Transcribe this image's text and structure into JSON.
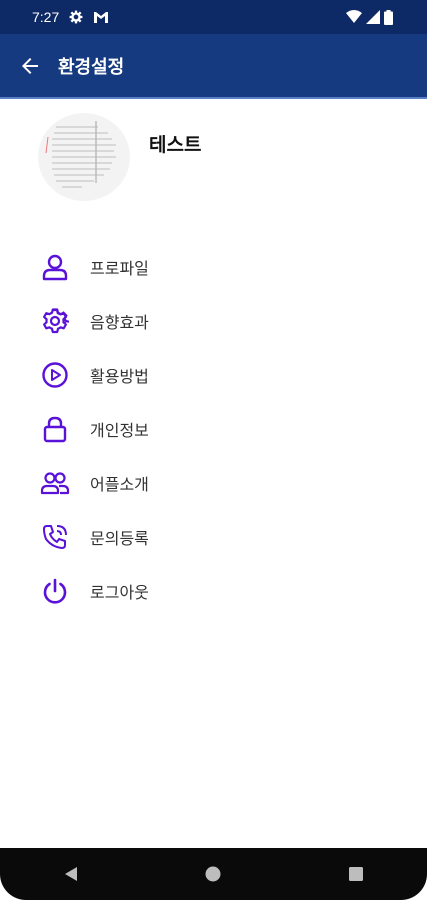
{
  "status_bar": {
    "time": "7:27"
  },
  "app_bar": {
    "title": "환경설정"
  },
  "profile": {
    "name": "테스트"
  },
  "menu": [
    {
      "label": "프로파일",
      "icon": "person-icon"
    },
    {
      "label": "음향효과",
      "icon": "gear-icon"
    },
    {
      "label": "활용방법",
      "icon": "play-circle-icon"
    },
    {
      "label": "개인정보",
      "icon": "lock-icon"
    },
    {
      "label": "어플소개",
      "icon": "people-icon"
    },
    {
      "label": "문의등록",
      "icon": "phone-icon"
    },
    {
      "label": "로그아웃",
      "icon": "power-icon"
    }
  ],
  "colors": {
    "status_bar": "#0e2a66",
    "app_bar": "#163a80",
    "icon_accent": "#5a12d8",
    "nav_bar": "#0a0a0a"
  }
}
